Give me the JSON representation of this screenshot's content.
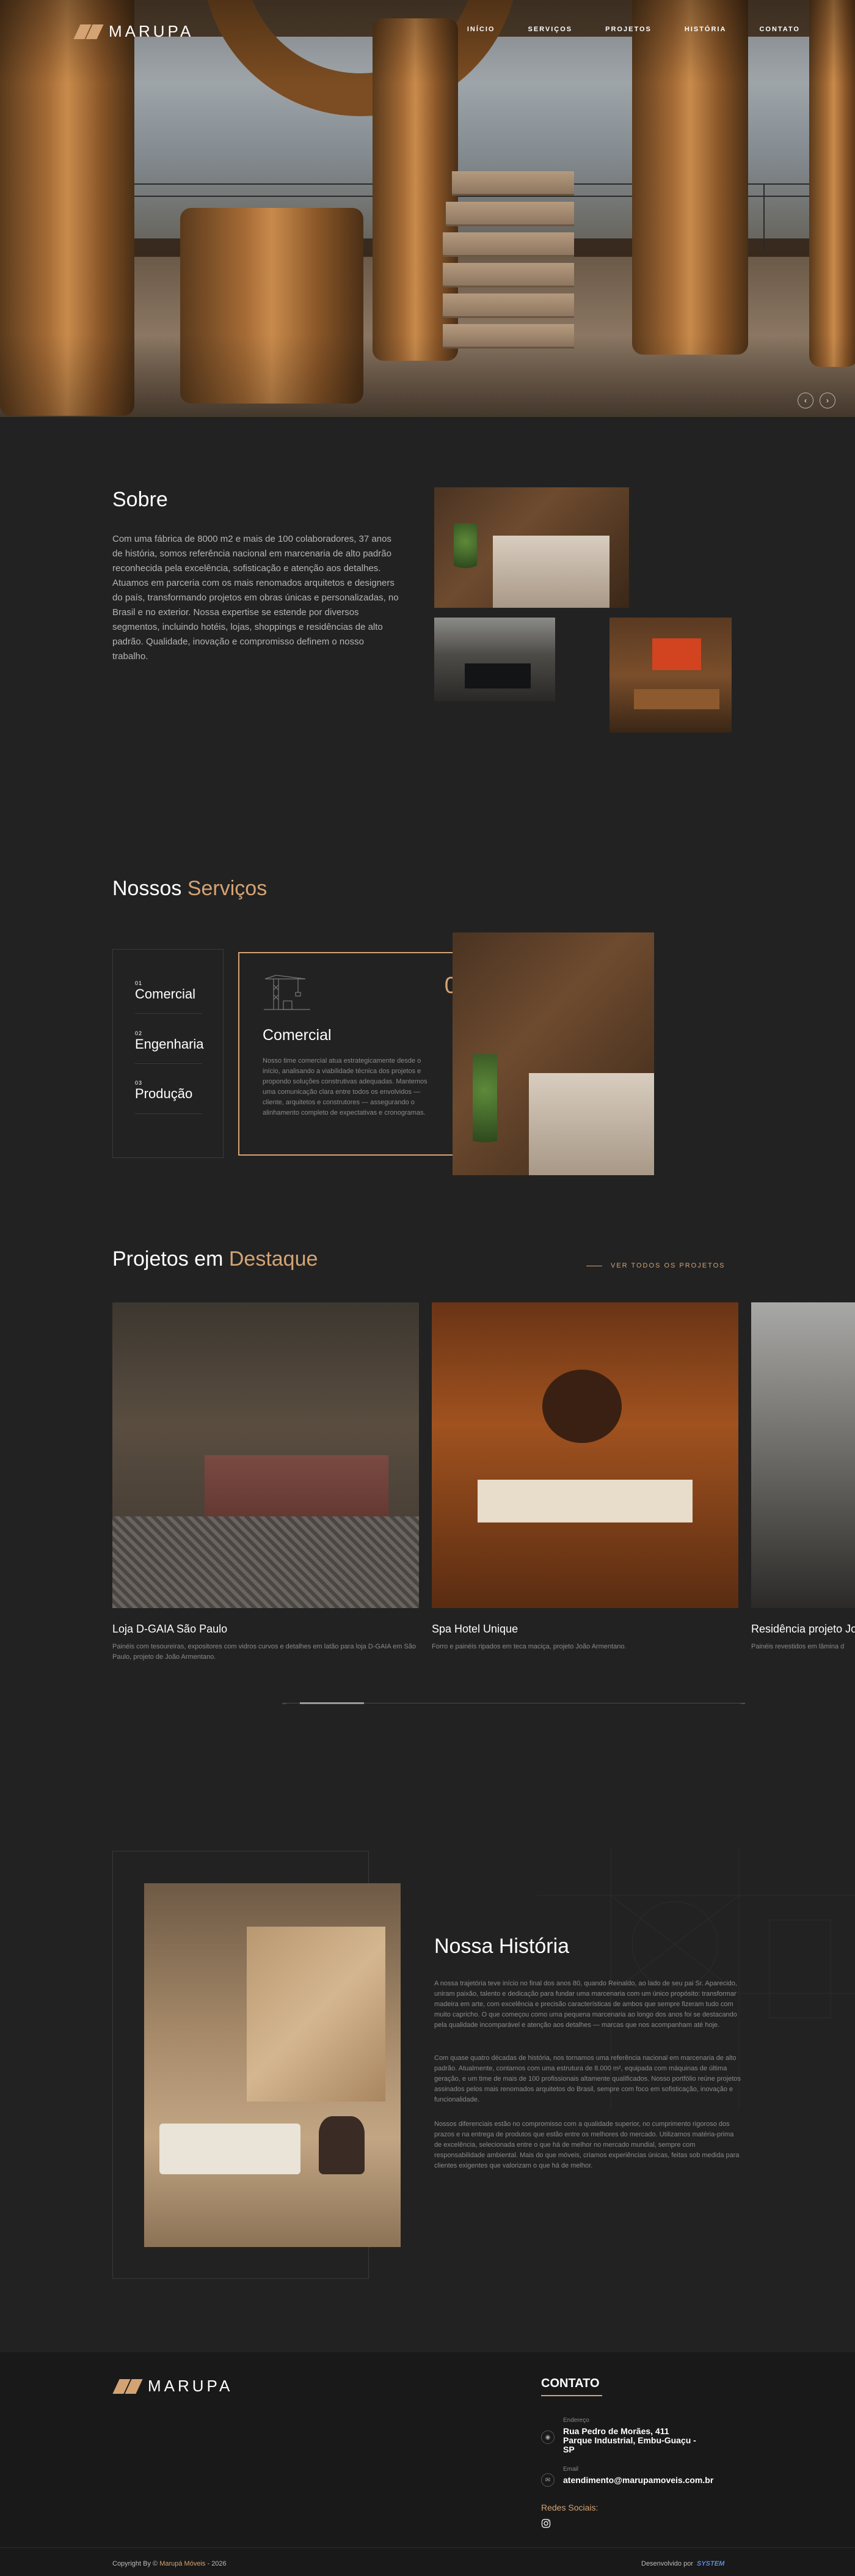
{
  "brand": {
    "name": "MARUPA",
    "accent": "#d4a373"
  },
  "nav": {
    "items": [
      "INÍCIO",
      "SERVIÇOS",
      "PROJETOS",
      "HISTÓRIA",
      "CONTATO"
    ]
  },
  "hero": {
    "prev_icon": "‹",
    "next_icon": "›"
  },
  "about": {
    "title": "Sobre",
    "text": "Com uma fábrica de 8000 m2 e mais de 100 colaboradores, 37 anos de história, somos referência nacional em marcenaria de alto padrão reconhecida pela excelência, sofisticação e atenção aos detalhes. Atuamos em parceria com os mais renomados arquitetos e designers do país, transformando projetos em obras únicas e personalizadas, no Brasil e no exterior. Nossa expertise se estende por diversos segmentos, incluindo hotéis, lojas, shoppings e residências de alto padrão. Qualidade, inovação e compromisso definem o nosso trabalho."
  },
  "services": {
    "title_part1": "Nossos",
    "title_part2": "Serviços",
    "items": [
      {
        "num": "01",
        "label": "Comercial"
      },
      {
        "num": "02",
        "label": "Engenharia"
      },
      {
        "num": "03",
        "label": "Produção"
      }
    ],
    "active": {
      "num": "01",
      "title": "Comercial",
      "text": "Nosso time comercial atua estrategicamente desde o início, analisando a viabilidade técnica dos projetos e propondo soluções construtivas adequadas. Mantemos uma comunicação clara entre todos os envolvidos — cliente, arquitetos e construtores — assegurando o alinhamento completo de expectativas e cronogramas."
    }
  },
  "projects": {
    "title_part1": "Projetos em",
    "title_part2": "Destaque",
    "view_all": "VER TODOS OS PROJETOS",
    "items": [
      {
        "title": "Loja D-GAIA São Paulo",
        "desc": "Painéis com tesoureiras, expositores com vidros curvos e detalhes em latão para loja D-GAIA em São Paulo, projeto de João Armentano."
      },
      {
        "title": "Spa Hotel Unique",
        "desc": "Forro e painéis ripados em teca maciça, projeto João Armentano."
      },
      {
        "title": "Residência projeto Jo",
        "desc": "Painéis revestidos em lâmina d"
      }
    ],
    "prev_icon": "←",
    "next_icon": "→"
  },
  "history": {
    "title": "Nossa História",
    "p1": "A nossa trajetória teve início no final dos anos 80, quando Reinaldo, ao lado de seu pai Sr. Aparecido, uniram paixão, talento e dedicação para fundar uma marcenaria com um único propósito: transformar madeira em arte, com excelência e precisão características de ambos que sempre fizeram tudo com muito capricho. O que começou como uma pequena marcenaria ao longo dos anos foi se destacando pela qualidade incomparável e atenção aos detalhes — marcas que nos acompanham até hoje.",
    "p2": "Com quase quatro décadas de história, nos tornamos uma referência nacional em marcenaria de alto padrão. Atualmente, contamos com uma estrutura de 8.000 m², equipada com máquinas de última geração, e um time de mais de 100 profissionais altamente qualificados. Nosso portfólio reúne projetos assinados pelos mais renomados arquitetos do Brasil, sempre com foco em sofisticação, inovação e funcionalidade.",
    "p3": "Nossos diferenciais estão no compromisso com a qualidade superior, no cumprimento rigoroso dos prazos e na entrega de produtos que estão entre os melhores do mercado. Utilizamos matéria-prima de excelência, selecionada entre o que há de melhor no mercado mundial, sempre com responsabilidade ambiental. Mais do que móveis, criamos experiências únicas, feitas sob medida para clientes exigentes que valorizam o que há de melhor."
  },
  "footer": {
    "contact_title": "CONTATO",
    "address_label": "Endereço",
    "address_line1": "Rua Pedro de Morães, 411",
    "address_line2": "Parque Industrial, Embu-Guaçu -",
    "address_line3": "SP",
    "email_label": "Email",
    "email": "atendimento@marupamoveis.com.br",
    "social_label": "Redes Sociais:",
    "copyright_prefix": "Copyright By ©",
    "copyright_brand": "Marupá Móveis",
    "copyright_year": "- 2026",
    "dev_prefix": "Desenvolvido por",
    "dev_brand": "SYSTEM"
  }
}
